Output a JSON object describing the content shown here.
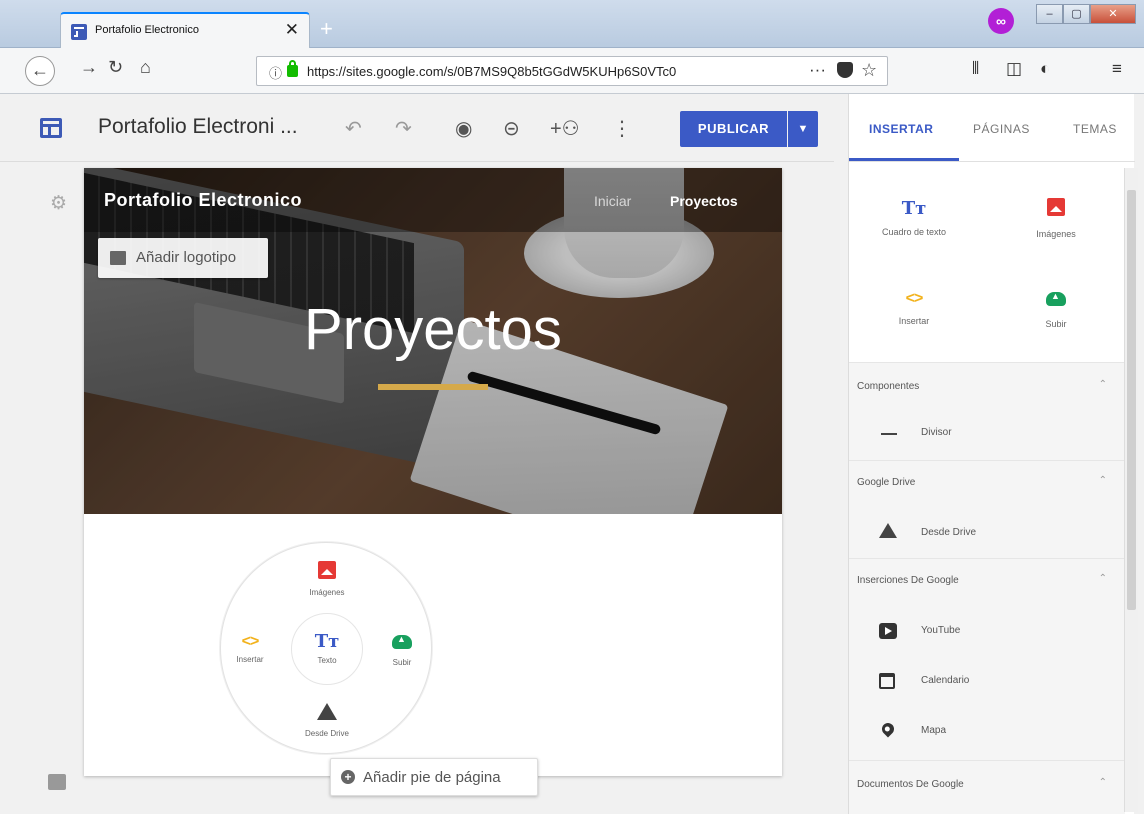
{
  "browser": {
    "tab_title": "Portafolio Electronico",
    "tab_close": "✕",
    "new_tab": "+",
    "url": "https://sites.google.com/s/0B7MS9Q8b5tGGdW5KUHp6S0VTc0",
    "url_menu": "···",
    "star": "☆",
    "profile_glyph": "∞"
  },
  "toolbar": {
    "site_title": "Portafolio Electroni ...",
    "publish_label": "PUBLICAR",
    "publish_caret": "▼"
  },
  "hero": {
    "site_name": "Portafolio Electronico",
    "nav_items": [
      "Iniciar",
      "Proyectos"
    ],
    "add_logo": "Añadir logotipo",
    "title": "Proyectos",
    "accent_color": "#d5a94a"
  },
  "radial_menu": {
    "top": "Imágenes",
    "left": "Insertar",
    "center": "Texto",
    "right": "Subir",
    "bottom": "Desde Drive"
  },
  "footer_button": "Añadir pie de página",
  "panel": {
    "tabs": [
      "INSERTAR",
      "PÁGINAS",
      "TEMAS"
    ],
    "grid": [
      "Cuadro de texto",
      "Imágenes",
      "Insertar",
      "Subir"
    ],
    "sections": [
      {
        "title": "Componentes",
        "items": [
          "Divisor"
        ]
      },
      {
        "title": "Google Drive",
        "items": [
          "Desde Drive"
        ]
      },
      {
        "title": "Inserciones De Google",
        "items": [
          "YouTube",
          "Calendario",
          "Mapa"
        ]
      },
      {
        "title": "Documentos De Google",
        "items": []
      }
    ]
  },
  "colors": {
    "accent": "#3b5ac6",
    "image_icon": "#e53935",
    "upload_icon": "#18a05e",
    "embed_icon": "#f2b21c"
  }
}
